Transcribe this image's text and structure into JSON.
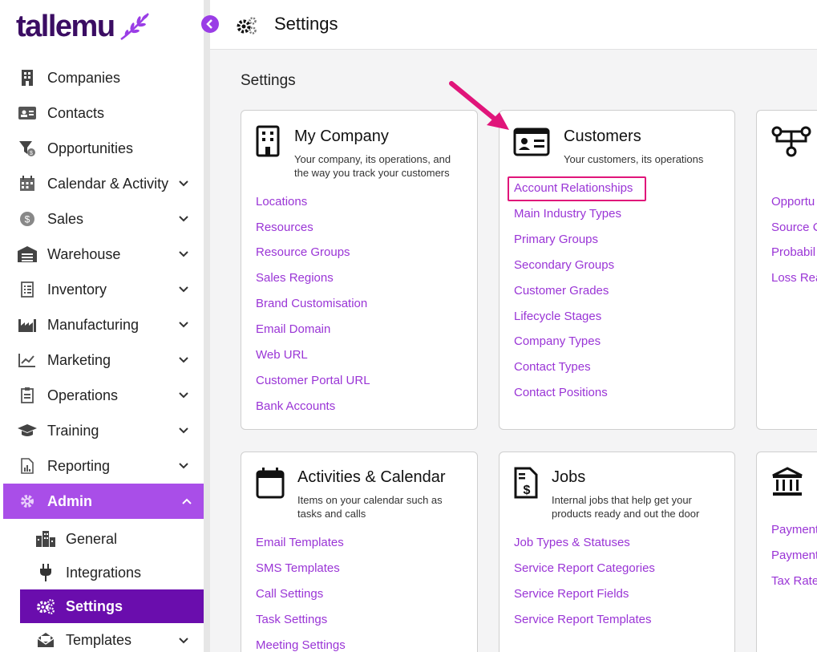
{
  "brand": {
    "logo_text": "tallemu"
  },
  "header": {
    "title": "Settings",
    "icon": "gears-icon"
  },
  "sidebar": {
    "items": [
      {
        "label": "Companies",
        "icon": "building-icon"
      },
      {
        "label": "Contacts",
        "icon": "id-card-icon"
      },
      {
        "label": "Opportunities",
        "icon": "funnel-icon"
      },
      {
        "label": "Calendar & Activity",
        "icon": "calendar-icon",
        "expandable": true
      },
      {
        "label": "Sales",
        "icon": "dollar-icon",
        "expandable": true
      },
      {
        "label": "Warehouse",
        "icon": "warehouse-icon",
        "expandable": true
      },
      {
        "label": "Inventory",
        "icon": "clipboard-list-icon",
        "expandable": true
      },
      {
        "label": "Manufacturing",
        "icon": "factory-icon",
        "expandable": true
      },
      {
        "label": "Marketing",
        "icon": "chart-line-icon",
        "expandable": true
      },
      {
        "label": "Operations",
        "icon": "clipboard-icon",
        "expandable": true
      },
      {
        "label": "Training",
        "icon": "graduation-cap-icon",
        "expandable": true
      },
      {
        "label": "Reporting",
        "icon": "report-icon",
        "expandable": true
      },
      {
        "label": "Admin",
        "icon": "gear-icon",
        "expanded": true
      }
    ],
    "sub_items": [
      {
        "label": "General",
        "icon": "city-icon"
      },
      {
        "label": "Integrations",
        "icon": "plug-icon"
      },
      {
        "label": "Settings",
        "icon": "gears-icon",
        "selected": true
      },
      {
        "label": "Templates",
        "icon": "envelope-open-icon",
        "expandable": true
      }
    ]
  },
  "main": {
    "title": "Settings",
    "cards": [
      {
        "title": "My Company",
        "description": [
          "Your company, its operations, and",
          "the way you track your customers"
        ],
        "links": [
          "Locations",
          "Resources",
          "Resource Groups",
          "Sales Regions",
          "Brand Customisation",
          "Email Domain",
          "Web URL",
          "Customer Portal URL",
          "Bank Accounts"
        ]
      },
      {
        "title": "Customers",
        "description": [
          "Your customers, its operations"
        ],
        "links": [
          "Account Relationships",
          "Main Industry Types",
          "Primary Groups",
          "Secondary Groups",
          "Customer Grades",
          "Lifecycle Stages",
          "Company Types",
          "Contact Types",
          "Contact Positions"
        ],
        "highlighted_link": "Account Relationships"
      },
      {
        "title": "",
        "description": [],
        "links": [
          "Opportu",
          "Source C",
          "Probabil",
          "Loss Rea"
        ]
      },
      {
        "title": "Activities & Calendar",
        "description": [
          "Items on your calendar such as",
          "tasks and calls"
        ],
        "links": [
          "Email Templates",
          "SMS Templates",
          "Call Settings",
          "Task Settings",
          "Meeting Settings"
        ]
      },
      {
        "title": "Jobs",
        "description": [
          "Internal jobs that help get your",
          "products ready and out the door"
        ],
        "links": [
          "Job Types & Statuses",
          "Service Report Categories",
          "Service Report Fields",
          "Service Report Templates"
        ]
      },
      {
        "title": "",
        "description": [],
        "links": [
          "Payment",
          "Payment",
          "Tax Rate"
        ]
      }
    ]
  },
  "colors": {
    "accent": "#a94ee8",
    "selected": "#6a0dad",
    "link": "#9a35d6",
    "annotation": "#e0157a",
    "brand": "#3b0d63"
  }
}
